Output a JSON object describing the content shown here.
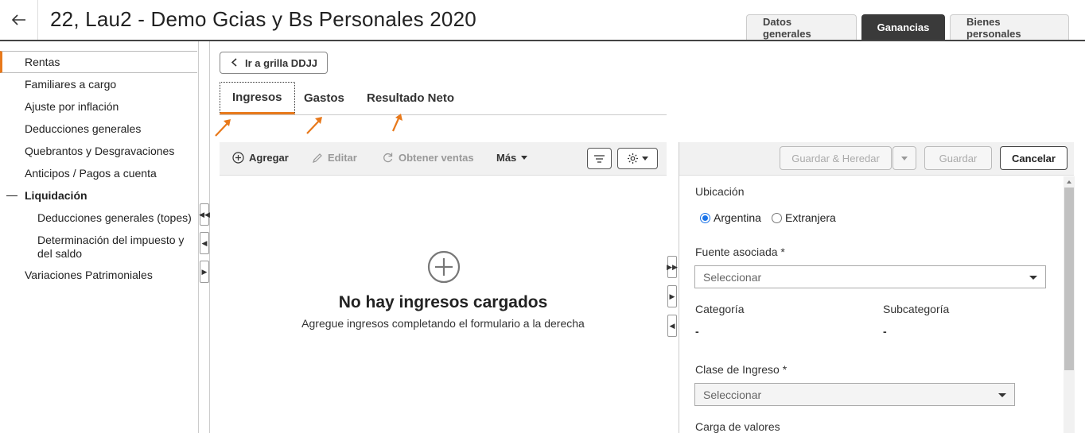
{
  "header": {
    "back_icon": "back-arrow-icon",
    "title": "22, Lau2 - Demo Gcias y Bs Personales 2020",
    "tabs": [
      {
        "label": "Datos generales",
        "active": false
      },
      {
        "label": "Ganancias",
        "active": true
      },
      {
        "label": "Bienes personales",
        "active": false
      }
    ]
  },
  "sidebar": {
    "items": [
      {
        "label": "Rentas"
      },
      {
        "label": "Familiares a cargo"
      },
      {
        "label": "Ajuste por inflación"
      },
      {
        "label": "Deducciones generales"
      },
      {
        "label": "Quebrantos y Desgravaciones"
      },
      {
        "label": "Anticipos / Pagos a cuenta"
      },
      {
        "label": "Liquidación"
      },
      {
        "label": "Deducciones generales (topes)"
      },
      {
        "label": "Determinación del impuesto y del saldo"
      },
      {
        "label": "Variaciones Patrimoniales"
      }
    ]
  },
  "main": {
    "back_button": "Ir a grilla DDJJ",
    "tabs": [
      {
        "label": "Ingresos",
        "active": true
      },
      {
        "label": "Gastos",
        "active": false
      },
      {
        "label": "Resultado Neto",
        "active": false
      }
    ],
    "accent_color": "#e8791b"
  },
  "list_panel": {
    "toolbar": {
      "add": "Agregar",
      "edit": "Editar",
      "get_sales": "Obtener ventas",
      "more": "Más"
    },
    "empty_title": "No hay ingresos cargados",
    "empty_subtitle": "Agregue ingresos completando el formulario a la derecha"
  },
  "form_panel": {
    "toolbar": {
      "save_inherit": "Guardar & Heredar",
      "save": "Guardar",
      "cancel": "Cancelar"
    },
    "location_label": "Ubicación",
    "location_options": [
      {
        "label": "Argentina",
        "selected": true
      },
      {
        "label": "Extranjera",
        "selected": false
      }
    ],
    "source_label": "Fuente asociada *",
    "source_placeholder": "Seleccionar",
    "category_label": "Categoría",
    "category_value": "-",
    "subcategory_label": "Subcategoría",
    "subcategory_value": "-",
    "income_class_label": "Clase de Ingreso *",
    "income_class_placeholder": "Seleccionar",
    "values_label": "Carga de valores"
  }
}
